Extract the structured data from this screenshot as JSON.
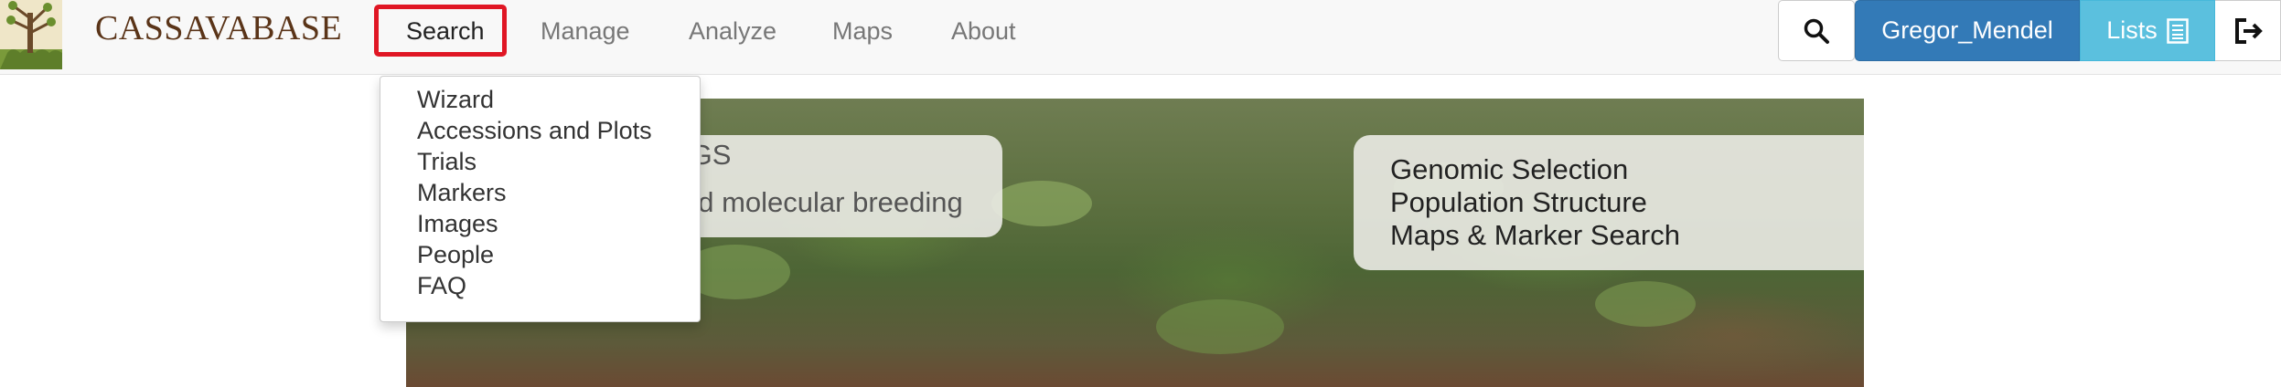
{
  "brand": {
    "name": "CASSAVABASE"
  },
  "nav": {
    "items": [
      {
        "label": "Search",
        "active": true
      },
      {
        "label": "Manage"
      },
      {
        "label": "Analyze"
      },
      {
        "label": "Maps"
      },
      {
        "label": "About"
      }
    ]
  },
  "toolbar": {
    "search_icon": "search-icon",
    "user_label": "Gregor_Mendel",
    "lists_label": "Lists",
    "lists_icon": "list-icon",
    "logout_icon": "logout-icon"
  },
  "search_menu": {
    "items": [
      "Wizard",
      "Accessions and Plots",
      "Trials",
      "Markers",
      "Images",
      "People",
      "FAQ"
    ]
  },
  "hero": {
    "left_lines": [
      "IGS",
      "nd molecular breeding"
    ],
    "right_lines": [
      "Genomic Selection",
      "Population Structure",
      "Maps & Marker Search"
    ]
  },
  "colors": {
    "highlight": "#e01624",
    "user_button": "#337ab7",
    "lists_button": "#5bc0de",
    "brand_text": "#5a3418"
  }
}
